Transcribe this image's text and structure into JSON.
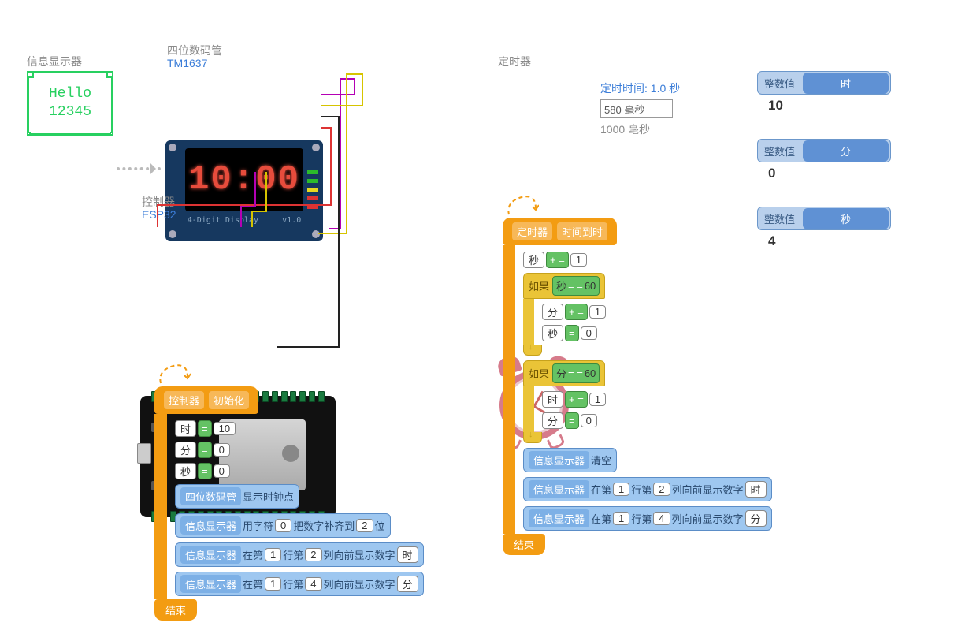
{
  "info_display": {
    "title": "信息显示器",
    "line1": "Hello",
    "line2": "12345"
  },
  "tm1637": {
    "title": "四位数码管",
    "model": "TM1637",
    "screen": "10:00",
    "footer_left": "4-Digit Display",
    "footer_right": "v1.0"
  },
  "controller": {
    "title": "控制器",
    "model": "ESP32"
  },
  "timer": {
    "title": "定时器",
    "duration_label": "定时时间: 1.0 秒",
    "input_value": "580 毫秒",
    "interval_label": "1000 毫秒"
  },
  "monitors": {
    "int_label": "整数值",
    "hour": {
      "name": "时",
      "value": "10"
    },
    "minute": {
      "name": "分",
      "value": "0"
    },
    "second": {
      "name": "秒",
      "value": "4"
    }
  },
  "vars": {
    "hour": "时",
    "minute": "分",
    "second": "秒"
  },
  "ops": {
    "assign": "=",
    "plus_assign": "+ =",
    "equals": "= ="
  },
  "keywords": {
    "if": "如果",
    "end": "结束",
    "init": "初始化",
    "controller": "控制器",
    "timer": "定时器",
    "on_time": "时间到时"
  },
  "devices": {
    "tm1637": "四位数码管",
    "info": "信息显示器"
  },
  "actions": {
    "show_clock_colon": "显示时钟点",
    "pad_prefix": "用字符",
    "pad_mid": "把数字补齐到",
    "pad_suffix": "位",
    "at_row": "在第",
    "at_col_prefix": "行第",
    "at_col_suffix": "列向前显示数字",
    "clear": "清空"
  },
  "init_block": {
    "assigns": [
      {
        "lhs": "时",
        "op": "=",
        "rhs": "10"
      },
      {
        "lhs": "分",
        "op": "=",
        "rhs": "0"
      },
      {
        "lhs": "秒",
        "op": "=",
        "rhs": "0"
      }
    ],
    "pad_char": "0",
    "pad_width": "2",
    "print1": {
      "row": "1",
      "col": "2",
      "var": "时"
    },
    "print2": {
      "row": "1",
      "col": "4",
      "var": "分"
    }
  },
  "timer_block": {
    "inc_sec": {
      "lhs": "秒",
      "op": "+ =",
      "rhs": "1"
    },
    "if1": {
      "cond_lhs": "秒",
      "cond_op": "= =",
      "cond_rhs": "60",
      "body": [
        {
          "lhs": "分",
          "op": "+ =",
          "rhs": "1"
        },
        {
          "lhs": "秒",
          "op": "=",
          "rhs": "0"
        }
      ]
    },
    "if2": {
      "cond_lhs": "分",
      "cond_op": "= =",
      "cond_rhs": "60",
      "body": [
        {
          "lhs": "时",
          "op": "+ =",
          "rhs": "1"
        },
        {
          "lhs": "分",
          "op": "=",
          "rhs": "0"
        }
      ]
    },
    "print1": {
      "row": "1",
      "col": "2",
      "var": "时"
    },
    "print2": {
      "row": "1",
      "col": "4",
      "var": "分"
    }
  }
}
